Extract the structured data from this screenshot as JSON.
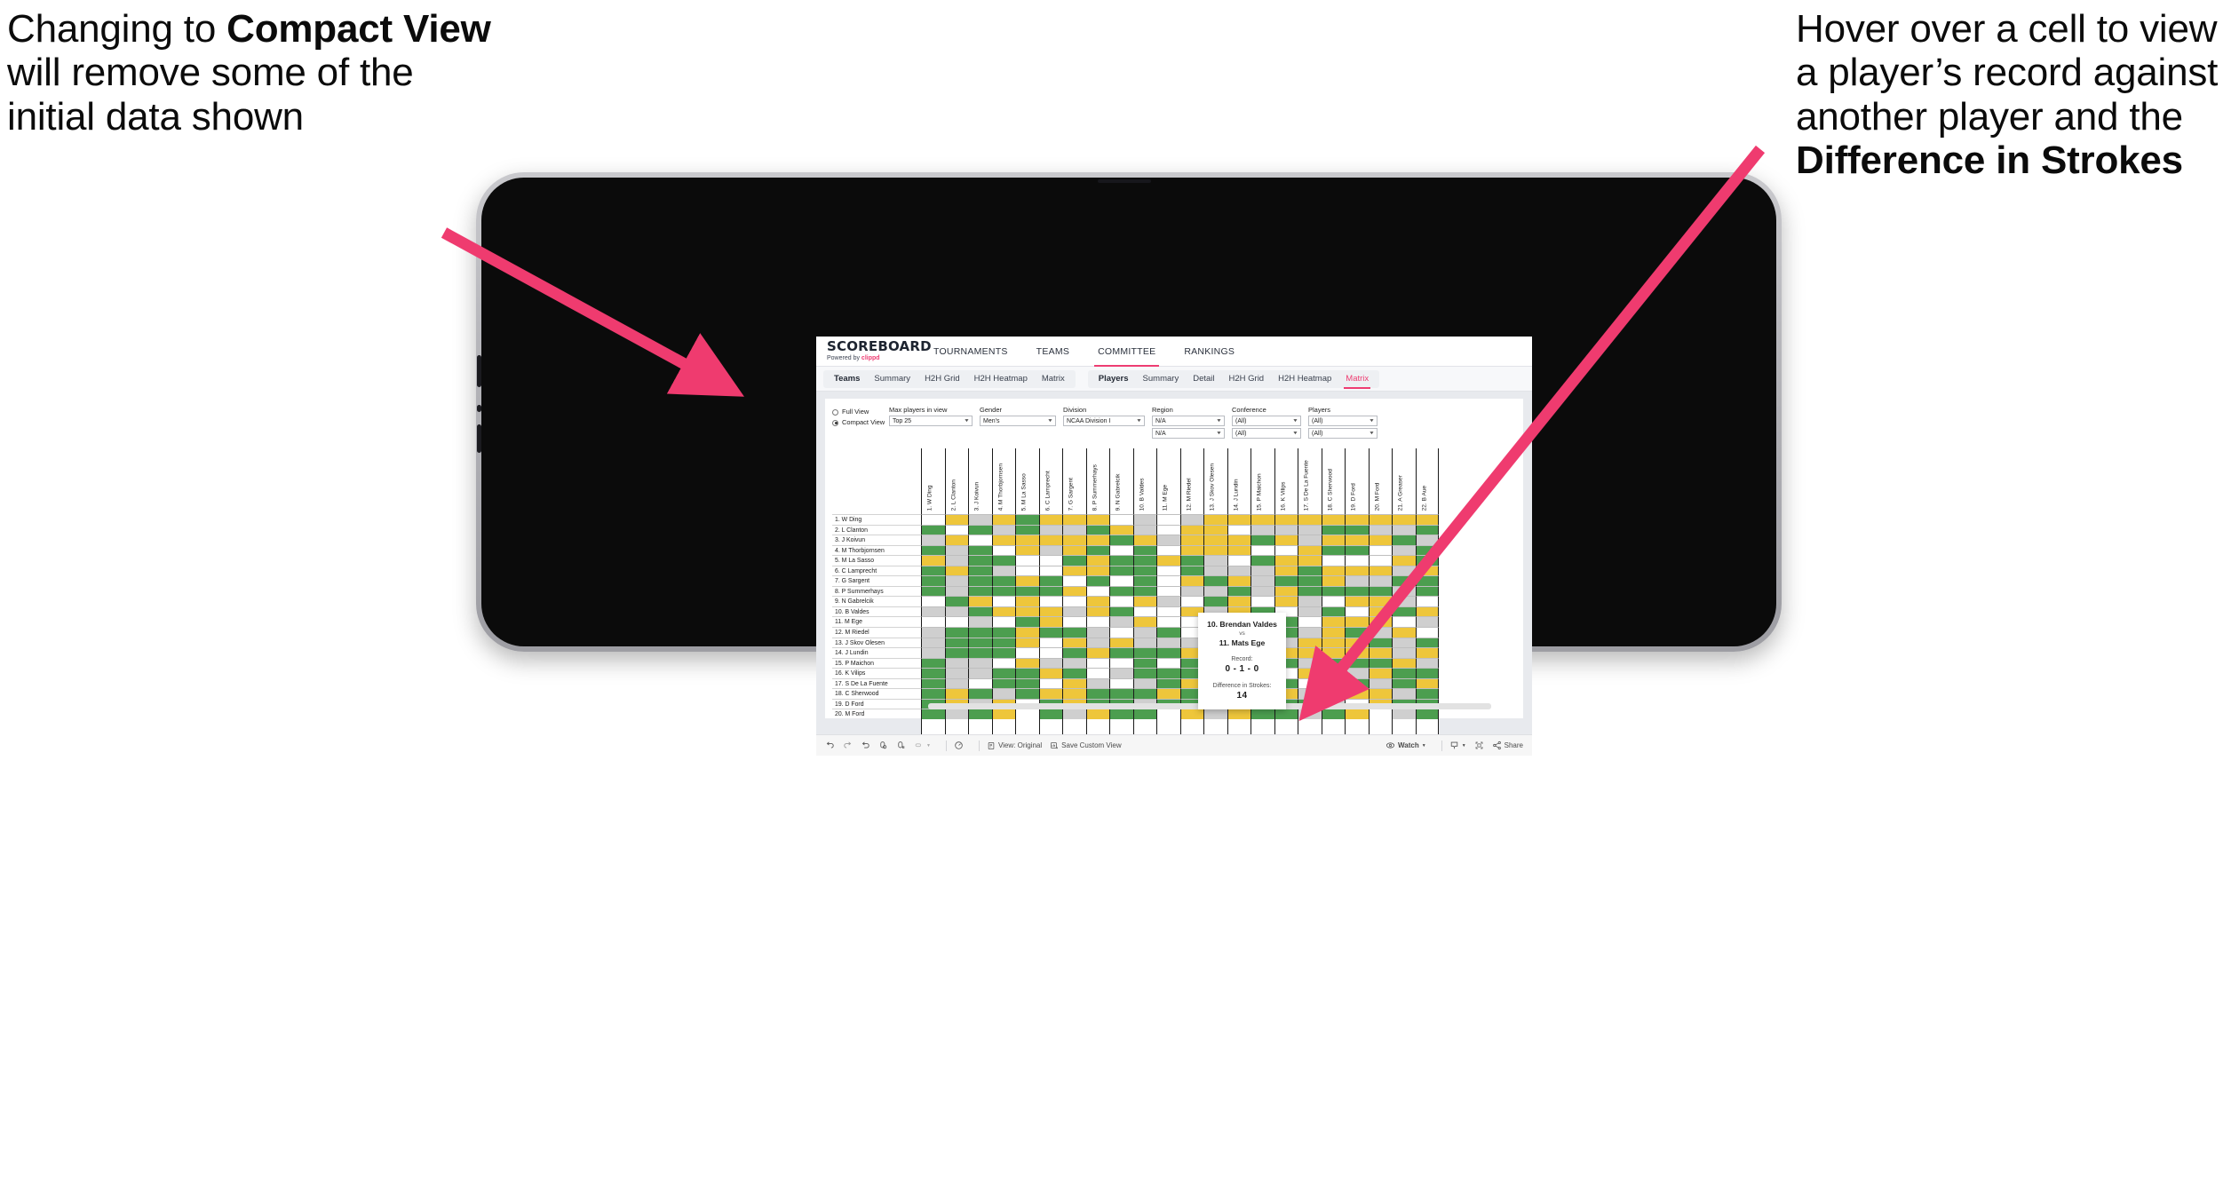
{
  "annotations": {
    "left": {
      "pre": "Changing to ",
      "bold": "Compact View",
      "post": " will remove some of the initial data shown"
    },
    "right": {
      "pre": "Hover over a cell to view a player’s record against another player and the ",
      "bold": "Difference in Strokes",
      "post": ""
    }
  },
  "colors": {
    "accent_pink": "#ee3d72",
    "arrow_pink": "#ef3b6f",
    "cell_green": "#4c9e4f",
    "cell_yellow": "#eec63b",
    "cell_gray": "#cfcfcf",
    "cell_white": "#ffffff",
    "device_black": "#0b0b0b",
    "device_frame": "#b4b4b9"
  },
  "app": {
    "brand": {
      "word": "SCOREBOARD",
      "powered_prefix": "Powered by ",
      "powered_brand": "clippd"
    },
    "main_nav": [
      {
        "label": "TOURNAMENTS",
        "active": false
      },
      {
        "label": "TEAMS",
        "active": false
      },
      {
        "label": "COMMITTEE",
        "active": true
      },
      {
        "label": "RANKINGS",
        "active": false
      }
    ],
    "sub_nav": {
      "teams_group": {
        "lead": "Teams",
        "tabs": [
          "Summary",
          "H2H Grid",
          "H2H Heatmap",
          "Matrix"
        ]
      },
      "players_group": {
        "lead": "Players",
        "tabs": [
          "Summary",
          "Detail",
          "H2H Grid",
          "H2H Heatmap",
          "Matrix"
        ],
        "active": "Matrix"
      }
    }
  },
  "filters": {
    "view_options": [
      {
        "label": "Full View",
        "selected": false
      },
      {
        "label": "Compact View",
        "selected": true
      }
    ],
    "fields": [
      {
        "label": "Max players in view",
        "value": "Top 25",
        "second": null
      },
      {
        "label": "Gender",
        "value": "Men's",
        "second": null
      },
      {
        "label": "Division",
        "value": "NCAA Division I",
        "second": null
      },
      {
        "label": "Region",
        "value": "N/A",
        "second": "N/A"
      },
      {
        "label": "Conference",
        "value": "(All)",
        "second": "(All)"
      },
      {
        "label": "Players",
        "value": "(All)",
        "second": "(All)"
      }
    ]
  },
  "matrix": {
    "row_labels": [
      "1. W Ding",
      "2. L Clanton",
      "3. J Koivun",
      "4. M Thorbjornsen",
      "5. M La Sasso",
      "6. C Lamprecht",
      "7. G Sargent",
      "8. P Summerhays",
      "9. N Gabrelcik",
      "10. B Valdes",
      "11. M Ege",
      "12. M Riedel",
      "13. J Skov Olesen",
      "14. J Lundin",
      "15. P Maichon",
      "16. K Vilips",
      "17. S De La Fuente",
      "18. C Sherwood",
      "19. D Ford",
      "20. M Ford"
    ],
    "col_labels": [
      "1. W Ding",
      "2. L Clanton",
      "3. J Koivun",
      "4. M Thorbjornsen",
      "5. M La Sasso",
      "6. C Lamprecht",
      "7. G Sargent",
      "8. P Summerhays",
      "9. N Gabrelcik",
      "10. B Valdes",
      "11. M Ege",
      "12. M Riedel",
      "13. J Skov Olesen",
      "14. J Lundin",
      "15. P Maichon",
      "16. K Vilips",
      "17. S De La Fuente",
      "18. C Sherwood",
      "19. D Ford",
      "20. M Ford",
      "21. A Greaser",
      "22. B Aue"
    ],
    "legend": {
      "g": "win",
      "y": "tie-or-mixed",
      "a": "loss",
      "w": "no-record"
    },
    "cells": [
      [
        "w",
        "y",
        "a",
        "y",
        "g",
        "y",
        "y",
        "y",
        "w",
        "a",
        "w",
        "a",
        "y",
        "y",
        "y",
        "y",
        "y",
        "y",
        "y",
        "y",
        "y",
        "y"
      ],
      [
        "g",
        "w",
        "g",
        "a",
        "g",
        "a",
        "a",
        "g",
        "y",
        "a",
        "w",
        "y",
        "y",
        "w",
        "a",
        "a",
        "a",
        "g",
        "g",
        "a",
        "a",
        "g"
      ],
      [
        "a",
        "y",
        "w",
        "y",
        "y",
        "y",
        "y",
        "y",
        "g",
        "y",
        "a",
        "y",
        "y",
        "y",
        "g",
        "y",
        "a",
        "y",
        "y",
        "y",
        "g",
        "a"
      ],
      [
        "g",
        "a",
        "g",
        "w",
        "y",
        "a",
        "y",
        "g",
        "w",
        "g",
        "w",
        "y",
        "y",
        "y",
        "w",
        "w",
        "y",
        "g",
        "g",
        "w",
        "a",
        "g"
      ],
      [
        "y",
        "a",
        "g",
        "g",
        "w",
        "w",
        "g",
        "y",
        "g",
        "g",
        "y",
        "g",
        "a",
        "w",
        "g",
        "y",
        "y",
        "w",
        "w",
        "w",
        "y",
        "g"
      ],
      [
        "g",
        "y",
        "g",
        "a",
        "w",
        "w",
        "y",
        "y",
        "g",
        "g",
        "w",
        "g",
        "a",
        "a",
        "a",
        "y",
        "g",
        "y",
        "y",
        "y",
        "a",
        "y"
      ],
      [
        "g",
        "a",
        "g",
        "g",
        "y",
        "g",
        "w",
        "g",
        "w",
        "g",
        "w",
        "y",
        "g",
        "y",
        "a",
        "g",
        "g",
        "y",
        "a",
        "a",
        "g",
        "g"
      ],
      [
        "g",
        "a",
        "g",
        "g",
        "g",
        "g",
        "y",
        "w",
        "g",
        "g",
        "w",
        "a",
        "a",
        "g",
        "a",
        "y",
        "g",
        "g",
        "g",
        "g",
        "a",
        "g"
      ],
      [
        "w",
        "g",
        "y",
        "w",
        "y",
        "w",
        "w",
        "y",
        "w",
        "y",
        "a",
        "w",
        "g",
        "y",
        "w",
        "y",
        "a",
        "w",
        "y",
        "y",
        "a",
        "w"
      ],
      [
        "a",
        "a",
        "g",
        "y",
        "y",
        "y",
        "a",
        "y",
        "g",
        "w",
        "w",
        "y",
        "a",
        "y",
        "g",
        "w",
        "a",
        "g",
        "w",
        "y",
        "g",
        "y"
      ],
      [
        "w",
        "w",
        "a",
        "w",
        "g",
        "y",
        "w",
        "w",
        "a",
        "y",
        "w",
        "w",
        "w",
        "g",
        "w",
        "g",
        "w",
        "y",
        "y",
        "y",
        "w",
        "a"
      ],
      [
        "a",
        "g",
        "g",
        "g",
        "y",
        "g",
        "g",
        "a",
        "w",
        "a",
        "g",
        "w",
        "g",
        "y",
        "y",
        "g",
        "a",
        "y",
        "g",
        "a",
        "y",
        "w"
      ],
      [
        "a",
        "g",
        "g",
        "g",
        "y",
        "w",
        "y",
        "a",
        "y",
        "a",
        "a",
        "a",
        "w",
        "g",
        "y",
        "a",
        "y",
        "y",
        "y",
        "g",
        "a",
        "g"
      ],
      [
        "a",
        "g",
        "g",
        "g",
        "w",
        "w",
        "g",
        "y",
        "g",
        "g",
        "g",
        "y",
        "y",
        "w",
        "y",
        "y",
        "y",
        "y",
        "y",
        "y",
        "a",
        "y"
      ],
      [
        "g",
        "a",
        "a",
        "w",
        "y",
        "a",
        "a",
        "w",
        "w",
        "g",
        "w",
        "g",
        "w",
        "y",
        "w",
        "g",
        "a",
        "g",
        "g",
        "g",
        "y",
        "a"
      ],
      [
        "g",
        "a",
        "a",
        "g",
        "g",
        "y",
        "g",
        "w",
        "a",
        "g",
        "g",
        "g",
        "g",
        "y",
        "a",
        "w",
        "y",
        "g",
        "a",
        "y",
        "g",
        "g"
      ],
      [
        "g",
        "a",
        "w",
        "g",
        "g",
        "w",
        "y",
        "a",
        "w",
        "a",
        "g",
        "y",
        "w",
        "y",
        "y",
        "g",
        "w",
        "a",
        "g",
        "a",
        "g",
        "y"
      ],
      [
        "g",
        "y",
        "g",
        "a",
        "g",
        "y",
        "y",
        "g",
        "g",
        "g",
        "y",
        "g",
        "y",
        "y",
        "g",
        "y",
        "a",
        "w",
        "y",
        "y",
        "a",
        "g"
      ],
      [
        "g",
        "y",
        "a",
        "y",
        "w",
        "g",
        "y",
        "g",
        "g",
        "a",
        "g",
        "g",
        "a",
        "a",
        "y",
        "g",
        "g",
        "a",
        "w",
        "y",
        "g",
        "g"
      ],
      [
        "g",
        "a",
        "g",
        "y",
        "w",
        "g",
        "a",
        "y",
        "g",
        "g",
        "w",
        "y",
        "a",
        "y",
        "g",
        "g",
        "a",
        "g",
        "y",
        "w",
        "a",
        "g"
      ]
    ]
  },
  "tooltip": {
    "player_a": "10. Brendan Valdes",
    "vs": "vs",
    "player_b": "11. Mats Ege",
    "record_label": "Record:",
    "record_value": "0 - 1 - 0",
    "diff_label": "Difference in Strokes:",
    "diff_value": "14"
  },
  "toolbar": {
    "left_icons": [
      "undo-icon",
      "redo-icon",
      "revert-icon",
      "refresh-icon",
      "pause-icon",
      "highlight-icon"
    ],
    "help_icon": "help-icon",
    "view_original": "View: Original",
    "save_custom_view": "Save Custom View",
    "watch": "Watch",
    "share": "Share",
    "download_icon": "download-icon",
    "fullscreen_icon": "fullscreen-icon"
  }
}
